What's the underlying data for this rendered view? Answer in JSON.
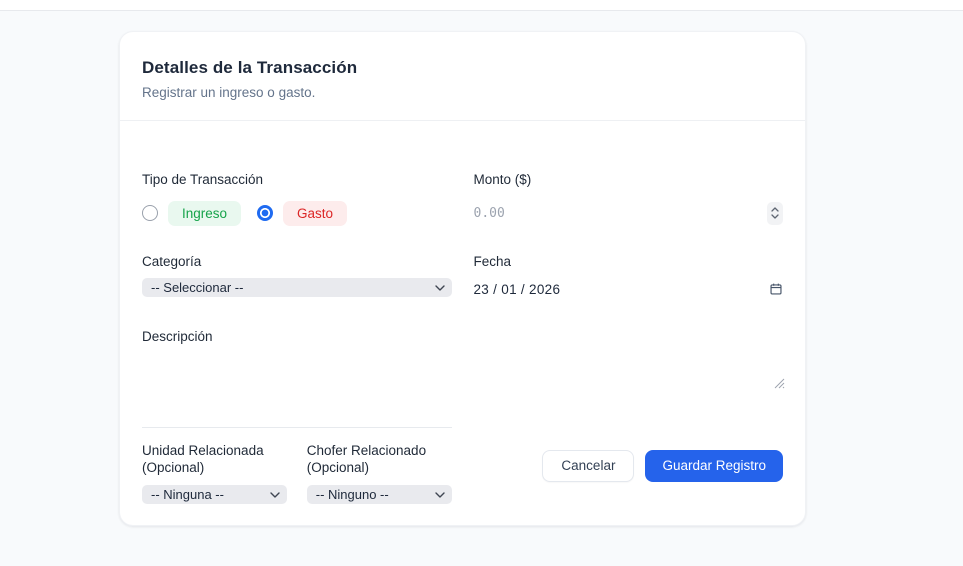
{
  "colors": {
    "page_bg": "#f8fafc",
    "card_bg": "#ffffff",
    "primary_blue": "#2563eb",
    "radio_checked_blue": "#1f6bf1",
    "ingreso_bg": "#e9f8ef",
    "ingreso_text": "#16a34a",
    "gasto_bg": "#fdecec",
    "gasto_text": "#dc2626",
    "select_bg": "#e9eaee",
    "divider": "#eef0f3"
  },
  "card": {
    "title": "Detalles de la Transacción",
    "subtitle": "Registrar un ingreso o gasto.",
    "tipo": {
      "label": "Tipo de Transacción",
      "options": [
        {
          "label": "Ingreso",
          "selected": false
        },
        {
          "label": "Gasto",
          "selected": true
        }
      ]
    },
    "monto": {
      "label": "Monto ($)",
      "placeholder": "0.00",
      "value": ""
    },
    "categoria": {
      "label": "Categoría",
      "value": "-- Seleccionar --"
    },
    "fecha": {
      "label": "Fecha",
      "value": "23/01/2026",
      "display": "23 / 01 / 2026"
    },
    "descripcion": {
      "label": "Descripción",
      "value": ""
    },
    "unidad": {
      "label": "Unidad Relacionada (Opcional)",
      "value": "-- Ninguna --"
    },
    "chofer": {
      "label": "Chofer Relacionado (Opcional)",
      "value": "-- Ninguno --"
    },
    "actions": {
      "cancel": "Cancelar",
      "save": "Guardar Registro"
    }
  }
}
